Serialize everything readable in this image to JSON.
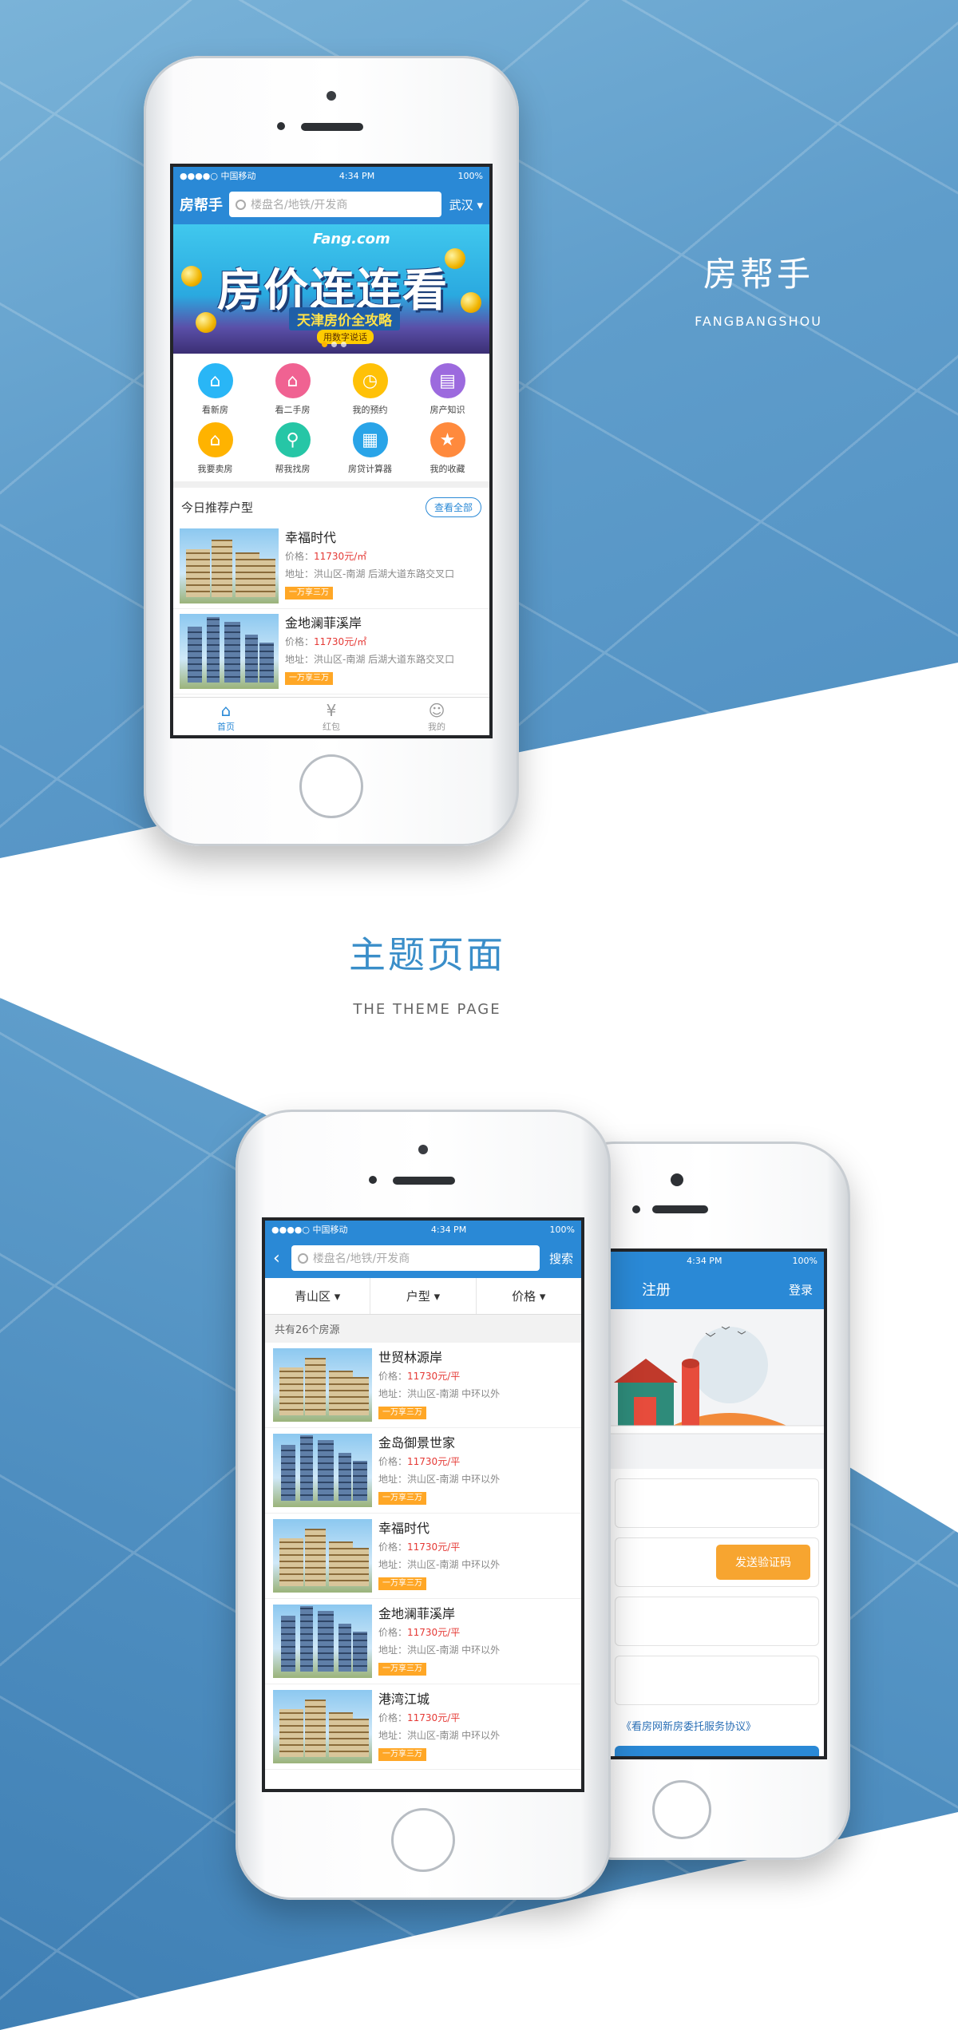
{
  "brand": {
    "title_cn": "房帮手",
    "title_en": "FANGBANGSHOU"
  },
  "section": {
    "title_cn": "主题页面",
    "title_en": "THE THEME PAGE"
  },
  "status_bar": {
    "carrier": "●●●●○ 中国移动",
    "time": "4:34 PM",
    "battery": "100%"
  },
  "home": {
    "logo": "房帮手",
    "search_placeholder": "楼盘名/地铁/开发商",
    "city": "武汉",
    "banner": {
      "mascot": "Fang.com",
      "headline": "房价连连看",
      "subline": "天津房价全攻略",
      "tag": "用数字说话"
    },
    "grid": [
      {
        "label": "看新房",
        "icon": "home-icon",
        "color": "#29b6f6",
        "glyph": "⌂"
      },
      {
        "label": "看二手房",
        "icon": "house-heart-icon",
        "color": "#f06292",
        "glyph": "⌂"
      },
      {
        "label": "我的预约",
        "icon": "alarm-clock-icon",
        "color": "#ffc107",
        "glyph": "◷"
      },
      {
        "label": "房产知识",
        "icon": "book-icon",
        "color": "#9c6ade",
        "glyph": "▤"
      },
      {
        "label": "我要卖房",
        "icon": "sell-house-icon",
        "color": "#ffb300",
        "glyph": "⌂"
      },
      {
        "label": "帮我找房",
        "icon": "location-pin-icon",
        "color": "#26c6a6",
        "glyph": "⚲"
      },
      {
        "label": "房贷计算器",
        "icon": "calculator-icon",
        "color": "#29a4e8",
        "glyph": "▦"
      },
      {
        "label": "我的收藏",
        "icon": "star-icon",
        "color": "#ff8a3d",
        "glyph": "★"
      }
    ],
    "recommend_title": "今日推荐户型",
    "view_all": "查看全部",
    "listings": [
      {
        "name": "幸福时代",
        "price_label": "价格：",
        "price": "11730元/㎡",
        "addr_label": "地址：",
        "addr": "洪山区-南湖 后湖大道东路交叉口",
        "badge": "一万享三万"
      },
      {
        "name": "金地澜菲溪岸",
        "price_label": "价格：",
        "price": "11730元/㎡",
        "addr_label": "地址：",
        "addr": "洪山区-南湖 后湖大道东路交叉口",
        "badge": "一万享三万"
      }
    ],
    "tabs": [
      {
        "label": "首页",
        "icon": "home-tab-icon",
        "glyph": "⌂"
      },
      {
        "label": "红包",
        "icon": "red-envelope-icon",
        "glyph": "¥"
      },
      {
        "label": "我的",
        "icon": "user-icon",
        "glyph": "☺"
      }
    ]
  },
  "list_page": {
    "search_placeholder": "楼盘名/地铁/开发商",
    "search_button": "搜索",
    "filters": [
      "青山区 ▾",
      "户型 ▾",
      "价格 ▾"
    ],
    "count_text": "共有26个房源",
    "listings": [
      {
        "name": "世贸林源岸",
        "price_label": "价格：",
        "price": "11730元/平",
        "addr_label": "地址：",
        "addr": "洪山区-南湖 中环以外",
        "badge": "一万享三万"
      },
      {
        "name": "金岛御景世家",
        "price_label": "价格：",
        "price": "11730元/平",
        "addr_label": "地址：",
        "addr": "洪山区-南湖 中环以外",
        "badge": "一万享三万"
      },
      {
        "name": "幸福时代",
        "price_label": "价格：",
        "price": "11730元/平",
        "addr_label": "地址：",
        "addr": "洪山区-南湖 中环以外",
        "badge": "一万享三万"
      },
      {
        "name": "金地澜菲溪岸",
        "price_label": "价格：",
        "price": "11730元/平",
        "addr_label": "地址：",
        "addr": "洪山区-南湖 中环以外",
        "badge": "一万享三万"
      },
      {
        "name": "港湾江城",
        "price_label": "价格：",
        "price": "11730元/平",
        "addr_label": "地址：",
        "addr": "洪山区-南湖 中环以外",
        "badge": "一万享三万"
      }
    ]
  },
  "register_page": {
    "title": "注册",
    "login": "登录",
    "send_code": "发送验证码",
    "agreement": "《看房网新房委托服务协议》"
  },
  "colors": {
    "primary": "#2a89d6",
    "price": "#e53935",
    "badge": "#ffa726"
  }
}
